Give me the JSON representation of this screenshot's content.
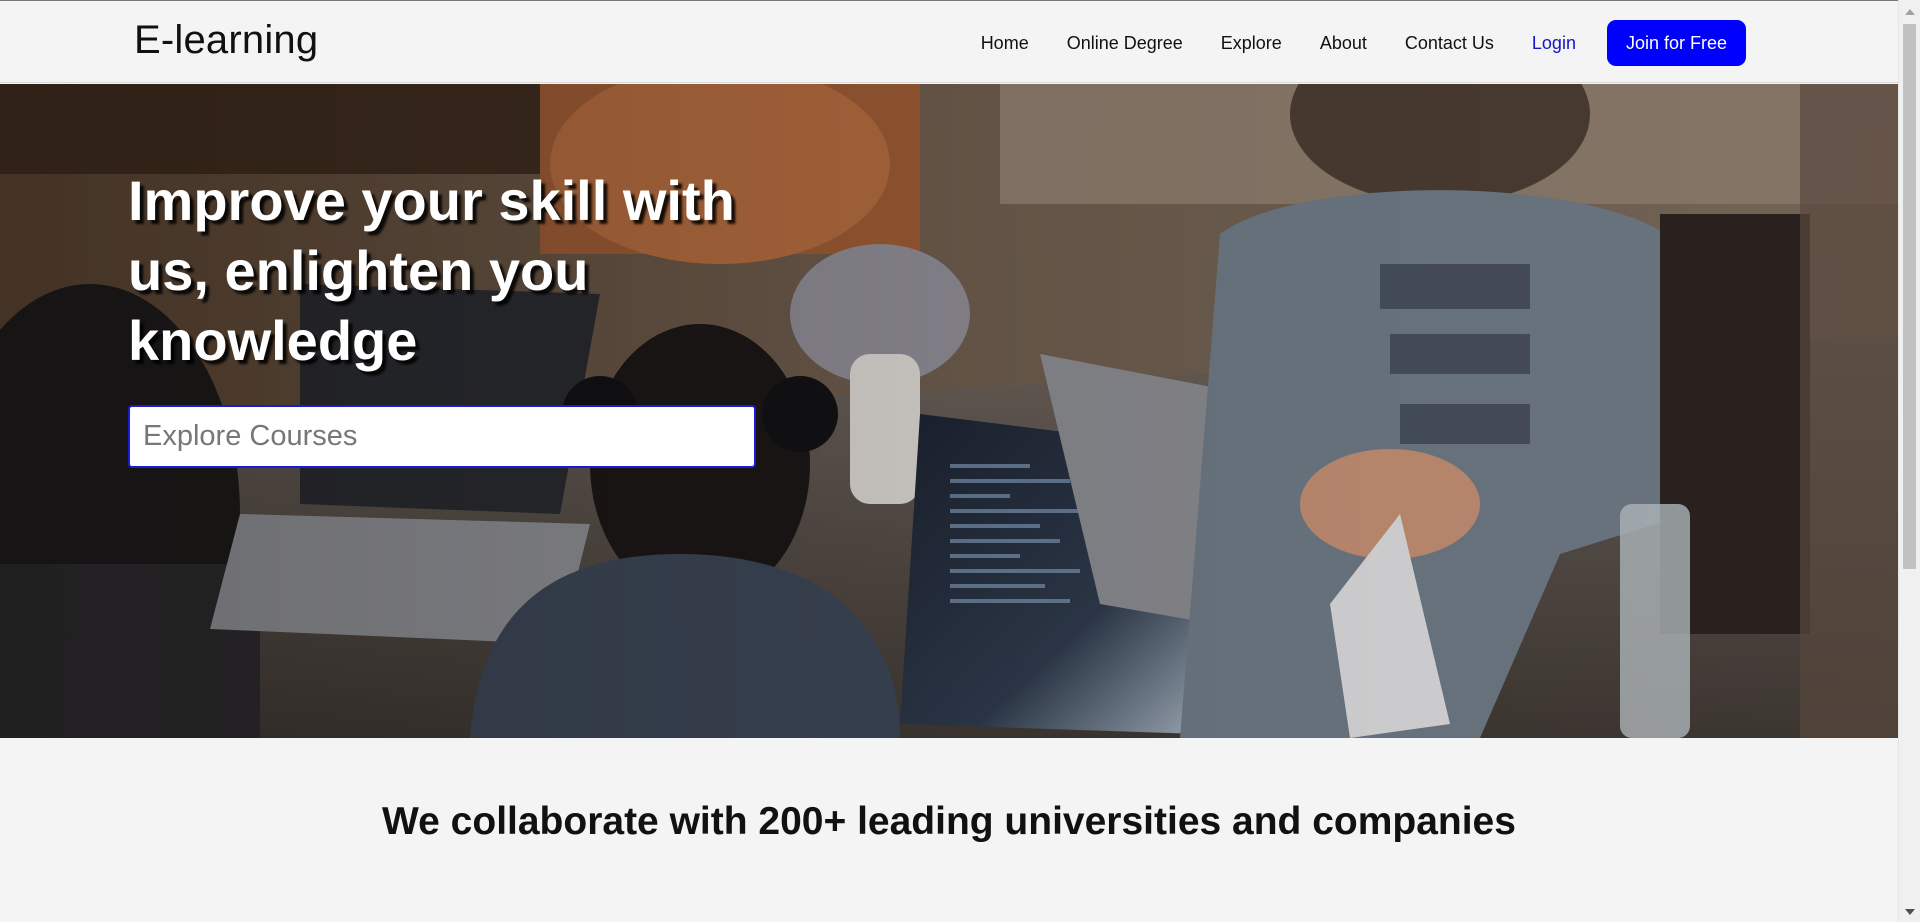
{
  "header": {
    "brand": "E-learning",
    "nav": [
      {
        "label": "Home"
      },
      {
        "label": "Online Degree"
      },
      {
        "label": "Explore"
      },
      {
        "label": "About"
      },
      {
        "label": "Contact Us"
      },
      {
        "label": "Login"
      }
    ],
    "cta_label": "Join for Free"
  },
  "hero": {
    "title": "Improve your skill with us, enlighten you knowledge",
    "search_placeholder": "Explore Courses",
    "background_image": "photo of people working on laptops at a shared table"
  },
  "collab": {
    "title": "We collaborate with 200+ leading universities and companies"
  },
  "colors": {
    "accent": "#0000ff",
    "login_link": "#1515c9",
    "page_bg": "#f4f4f4",
    "text": "#111111"
  }
}
